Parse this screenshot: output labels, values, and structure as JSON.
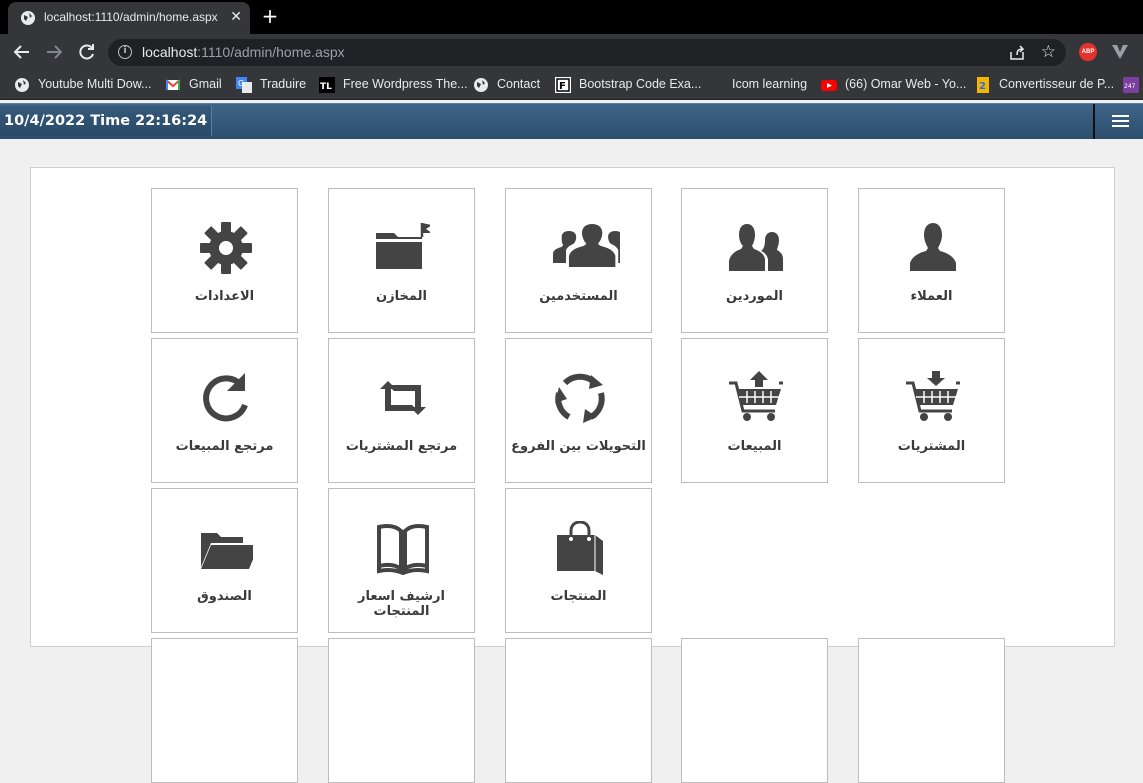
{
  "browser": {
    "tab_title": "localhost:1110/admin/home.aspx",
    "tab_close": "✕",
    "new_tab": "+",
    "url_host": "localhost",
    "url_rest": ":1110/admin/home.aspx",
    "abp_label": "ABP",
    "bookmarks": [
      {
        "label": "Youtube Multi Dow...",
        "icon": "globe-icon"
      },
      {
        "label": "Gmail",
        "icon": "gmail-icon"
      },
      {
        "label": "Traduire",
        "icon": "translate-icon"
      },
      {
        "label": "Free Wordpress The...",
        "icon": "tl-icon"
      },
      {
        "label": "Contact",
        "icon": "globe-icon"
      },
      {
        "label": "Bootstrap Code Exa...",
        "icon": "bootstrap-icon"
      },
      {
        "label": "Icom learning",
        "icon": "blank-icon"
      },
      {
        "label": "(66) Omar Web - Yo...",
        "icon": "youtube-icon"
      },
      {
        "label": "Convertisseur de P...",
        "icon": "convert-icon"
      },
      {
        "label": "247",
        "icon": "app247-icon"
      }
    ]
  },
  "header": {
    "datetime": "10/4/2022 Time 22:16:24"
  },
  "tiles": [
    {
      "label": "العملاء",
      "icon": "user-icon"
    },
    {
      "label": "الموردين",
      "icon": "suppliers-icon"
    },
    {
      "label": "المستخدمين",
      "icon": "users-group-icon"
    },
    {
      "label": "المخازن",
      "icon": "folder-flag-icon"
    },
    {
      "label": "الاعدادات",
      "icon": "gear-icon"
    },
    {
      "label": "المشتريات",
      "icon": "cart-down-icon"
    },
    {
      "label": "المبيعات",
      "icon": "cart-up-icon"
    },
    {
      "label": "التحويلات بين الفروع",
      "icon": "refresh-icon"
    },
    {
      "label": "مرتجع المشتريات",
      "icon": "retweet-icon"
    },
    {
      "label": "مرتجع المبيعات",
      "icon": "redo-icon"
    },
    {
      "label": "المنتجات",
      "icon": "shopping-bag-icon"
    },
    {
      "label": "ارشيف اسعار المنتجات",
      "icon": "book-icon"
    },
    {
      "label": "الصندوق",
      "icon": "folder-open-icon"
    }
  ],
  "colors": {
    "navbar": "#2d4f6e",
    "icon": "#444444",
    "tile_border": "#bdbdbd"
  }
}
